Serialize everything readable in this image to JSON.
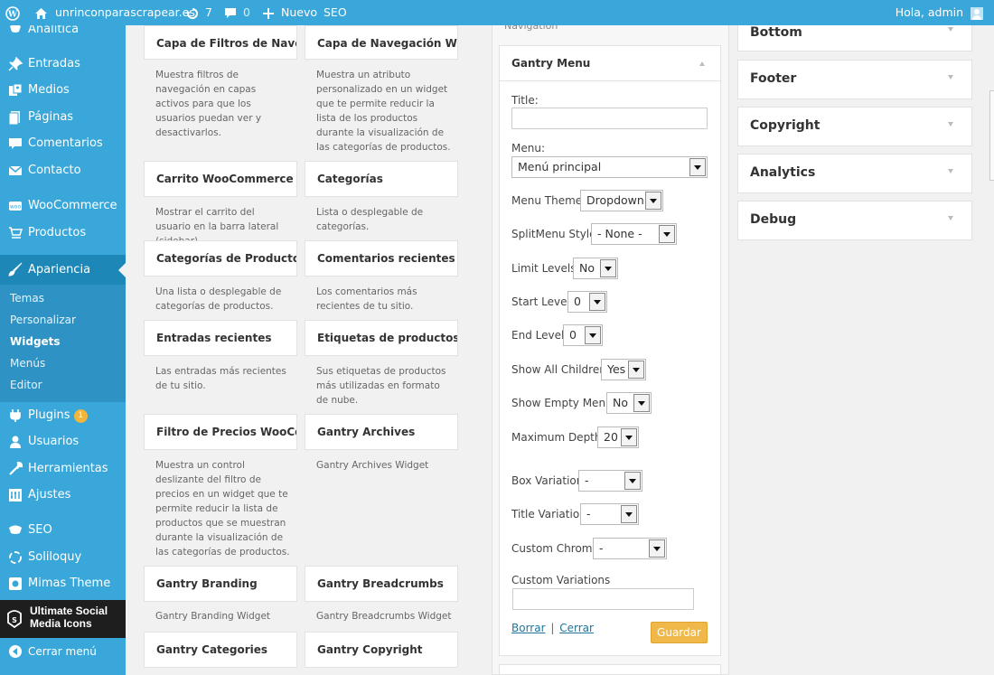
{
  "admin_bar": {
    "site_name": "unrinconparascrapear.es",
    "updates_count": "7",
    "comments_count": "0",
    "new_label": "Nuevo",
    "seo_label": "SEO",
    "greeting": "Hola, admin"
  },
  "sidebar": {
    "items": [
      {
        "label": "Analítica",
        "icon": "analytics-icon"
      },
      {
        "label": "Entradas",
        "icon": "pin-icon"
      },
      {
        "label": "Medios",
        "icon": "media-icon"
      },
      {
        "label": "Páginas",
        "icon": "pages-icon"
      },
      {
        "label": "Comentarios",
        "icon": "comments-icon"
      },
      {
        "label": "Contacto",
        "icon": "mail-icon"
      },
      {
        "label": "WooCommerce",
        "icon": "woocommerce-icon"
      },
      {
        "label": "Productos",
        "icon": "cart-icon"
      },
      {
        "label": "Apariencia",
        "icon": "brush-icon"
      }
    ],
    "submenu": [
      "Temas",
      "Personalizar",
      "Widgets",
      "Menús",
      "Editor"
    ],
    "items2": [
      {
        "label": "Plugins",
        "badge": "1",
        "icon": "plugin-icon"
      },
      {
        "label": "Usuarios",
        "icon": "users-icon"
      },
      {
        "label": "Herramientas",
        "icon": "tools-icon"
      },
      {
        "label": "Ajustes",
        "icon": "settings-icon"
      },
      {
        "label": "SEO",
        "icon": "seo-icon"
      },
      {
        "label": "Soliloquy",
        "icon": "soliloquy-icon"
      },
      {
        "label": "Mimas Theme",
        "icon": "theme-icon"
      }
    ],
    "usmi_line1": "Ultimate Social",
    "usmi_line2": "Media Icons",
    "collapse_label": "Cerrar menú"
  },
  "widgets": [
    {
      "title": "Capa de Filtros de Nave...",
      "desc": "Muestra filtros de navegación en capas activos para que los usuarios puedan ver y desactivarlos."
    },
    {
      "title": "Capa de Navegación Wo...",
      "desc": "Muestra un atributo personalizado en un widget que te permite reducir la lista de los productos durante la visualización de las categorías de productos."
    },
    {
      "title": "Carrito WooCommerce",
      "desc": "Mostrar el carrito del usuario en la barra lateral (sidebar)."
    },
    {
      "title": "Categorías",
      "desc": "Lista o desplegable de categorías."
    },
    {
      "title": "Categorías de Productos...",
      "desc": "Una lista o desplegable de categorías de productos."
    },
    {
      "title": "Comentarios recientes",
      "desc": "Los comentarios más recientes de tu sitio."
    },
    {
      "title": "Entradas recientes",
      "desc": "Las entradas más recientes de tu sitio."
    },
    {
      "title": "Etiquetas de productos ...",
      "desc": "Sus etiquetas de productos más utilizadas en formato de nube."
    },
    {
      "title": "Filtro de Precios WooCo...",
      "desc": "Muestra un control deslizante del filtro de precios en un widget que te permite reducir la lista de productos que se muestran durante la visualización de las categorías de productos."
    },
    {
      "title": "Gantry Archives",
      "desc": "Gantry Archives Widget"
    },
    {
      "title": "Gantry Branding",
      "desc": "Gantry Branding Widget"
    },
    {
      "title": "Gantry Breadcrumbs",
      "desc": "Gantry Breadcrumbs Widget"
    },
    {
      "title": "Gantry Categories",
      "desc": ""
    },
    {
      "title": "Gantry Copyright",
      "desc": ""
    }
  ],
  "navigation_area_label": "Navigation",
  "gantry_menu": {
    "title": "Gantry Menu",
    "fields": {
      "title_label": "Title:",
      "title_value": "",
      "menu_label": "Menu:",
      "menu_value": "Menú principal",
      "menu_theme_label": "Menu Theme:",
      "menu_theme_value": "Dropdown",
      "splitmenu_label": "SplitMenu Style:",
      "splitmenu_value": "- None -",
      "limit_levels_label": "Limit Levels:",
      "limit_levels_value": "No",
      "start_level_label": "Start Level:",
      "start_level_value": "0",
      "end_level_label": "End Level:",
      "end_level_value": "0",
      "show_all_children_label": "Show All Children:",
      "show_all_children_value": "Yes",
      "show_empty_menu_label": "Show Empty Menu:",
      "show_empty_menu_value": "No",
      "max_depth_label": "Maximum Depth:",
      "max_depth_value": "20",
      "box_variation_label": "Box Variation",
      "box_variation_value": "-",
      "title_variation_label": "Title Variation",
      "title_variation_value": "-",
      "custom_chrome_label": "Custom Chrome",
      "custom_chrome_value": "-",
      "custom_variations_label": "Custom Variations",
      "custom_variations_value": ""
    },
    "delete_link": "Borrar",
    "separator": "|",
    "close_link": "Cerrar",
    "save_button": "Guardar"
  },
  "sidebars": [
    "Bottom",
    "Footer",
    "Copyright",
    "Analytics",
    "Debug"
  ],
  "colors": {
    "admin_blue": "#39a7d9",
    "active_blue": "#1d88b7",
    "save_button": "#f0b849",
    "badge": "#f4b53b"
  }
}
